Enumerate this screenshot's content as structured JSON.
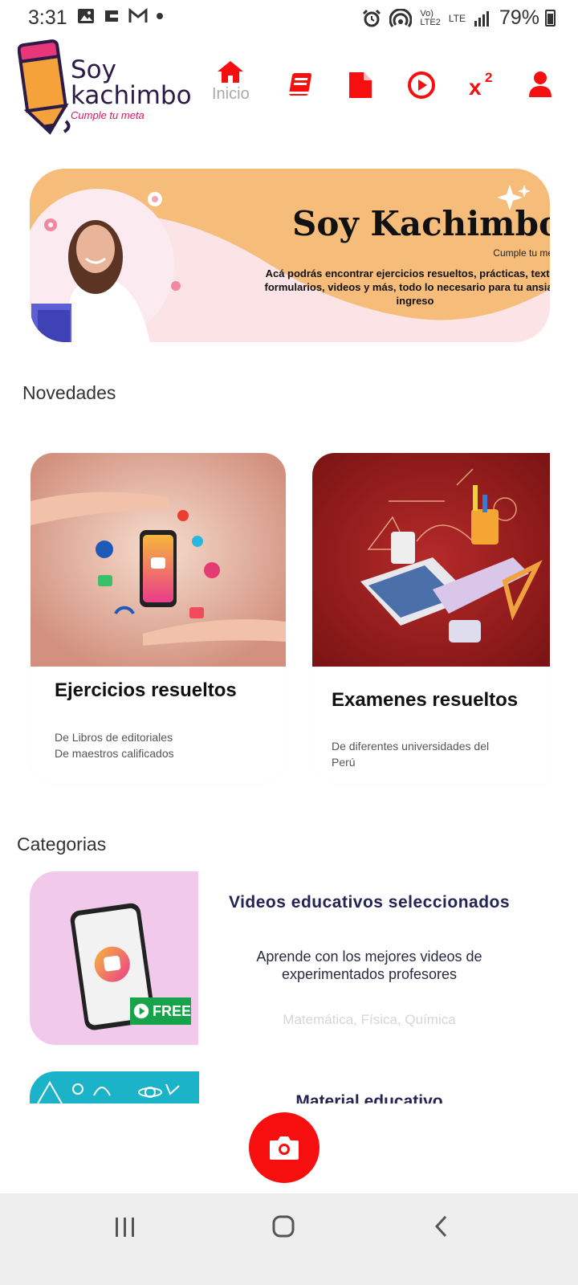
{
  "status_bar": {
    "time": "3:31",
    "network_label_top": "Vo)",
    "network_label_bottom": "LTE2",
    "lte_label": "LTE",
    "battery": "79%"
  },
  "brand": {
    "name_line1": "Soy",
    "name_line2": "kachimbo",
    "tagline": "Cumple tu meta"
  },
  "nav": {
    "items": [
      {
        "icon": "home-icon",
        "label": "Inicio",
        "active": true
      },
      {
        "icon": "book-icon",
        "label": ""
      },
      {
        "icon": "document-icon",
        "label": ""
      },
      {
        "icon": "play-icon",
        "label": ""
      },
      {
        "icon": "superscript-icon",
        "label": "x²"
      },
      {
        "icon": "user-icon",
        "label": ""
      }
    ],
    "accent_color": "#f70e0e"
  },
  "banner": {
    "title": "Soy Kachimbo",
    "subtitle": "Cumple tu meta",
    "description": "Acá podrás encontrar ejercicios resueltos, prácticas, textos, formularios, videos y más, todo lo necesario para tu ansiado ingreso"
  },
  "news": {
    "heading": "Novedades",
    "cards": [
      {
        "title": "Ejercicios resueltos",
        "line1": "De Libros de editoriales",
        "line2": "De maestros calificados"
      },
      {
        "title": "Examenes resueltos",
        "line1": "De diferentes universidades del",
        "line2": "Perú"
      }
    ]
  },
  "categories": {
    "heading": "Categorias",
    "items": [
      {
        "title": "Videos educativos seleccionados",
        "description_line1": "Aprende con los mejores videos de",
        "description_line2": "experimentados profesores",
        "subjects": "Matemática, Física, Química",
        "badge": "FREE"
      },
      {
        "title": "Material educativo"
      }
    ]
  },
  "fab": {
    "icon": "camera-icon"
  },
  "system_nav": {
    "icons": [
      "recent-apps-icon",
      "home-button-icon",
      "back-icon"
    ]
  }
}
